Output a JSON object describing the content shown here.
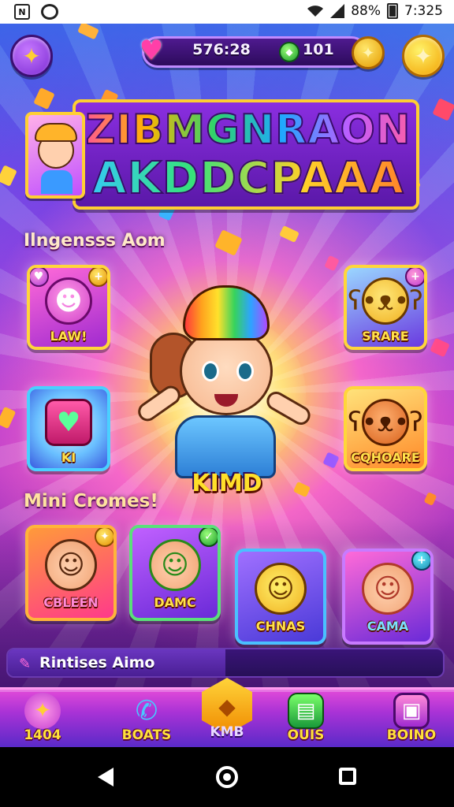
{
  "status_bar": {
    "battery": "88%",
    "time": "7:325"
  },
  "hud": {
    "timer": "576:28",
    "gems": "101",
    "icons": [
      "menu-icon",
      "heart-icon",
      "gem-icon",
      "coin-icon",
      "settings-icon"
    ]
  },
  "logo": {
    "line1": "ZIBMGNRAON",
    "line2": "AKDDCPAAA"
  },
  "sections": {
    "top_label": "Ilngensss Aom",
    "mini_label": "Mini Cromes!"
  },
  "feature_tiles": [
    {
      "label": "LAW!",
      "icon": "pink-monster-icon"
    },
    {
      "label": "SRARE",
      "icon": "yellow-bear-icon"
    },
    {
      "label": "KI",
      "icon": "heart-gem-icon"
    },
    {
      "label": "CQHOARE",
      "icon": "orange-bear-icon"
    }
  ],
  "hero": {
    "name": "KIMD"
  },
  "mini_games": [
    {
      "label": "CBLEEN",
      "icon": "blond-kid-icon"
    },
    {
      "label": "DAMC",
      "icon": "green-hair-kid-icon"
    },
    {
      "label": "CHNAS",
      "icon": "yellow-creature-icon"
    },
    {
      "label": "CAMA",
      "icon": "rainbow-hair-kid-icon"
    }
  ],
  "progress": {
    "label": "Rintises Aimo",
    "fill_fraction": 0.5
  },
  "bottom_nav": [
    {
      "label": "1404",
      "icon": "carrot-icon"
    },
    {
      "label": "BOATS",
      "icon": "phone-icon"
    },
    {
      "label": "KMB",
      "icon": "hexagon-gem-icon"
    },
    {
      "label": "OUIS",
      "icon": "book-icon"
    },
    {
      "label": "BOINO",
      "icon": "tv-icon"
    }
  ],
  "colors": {
    "accent_gold": "#ffd63a",
    "background_purple": "#8b2ee0",
    "label_yellow": "#ffe24a"
  }
}
